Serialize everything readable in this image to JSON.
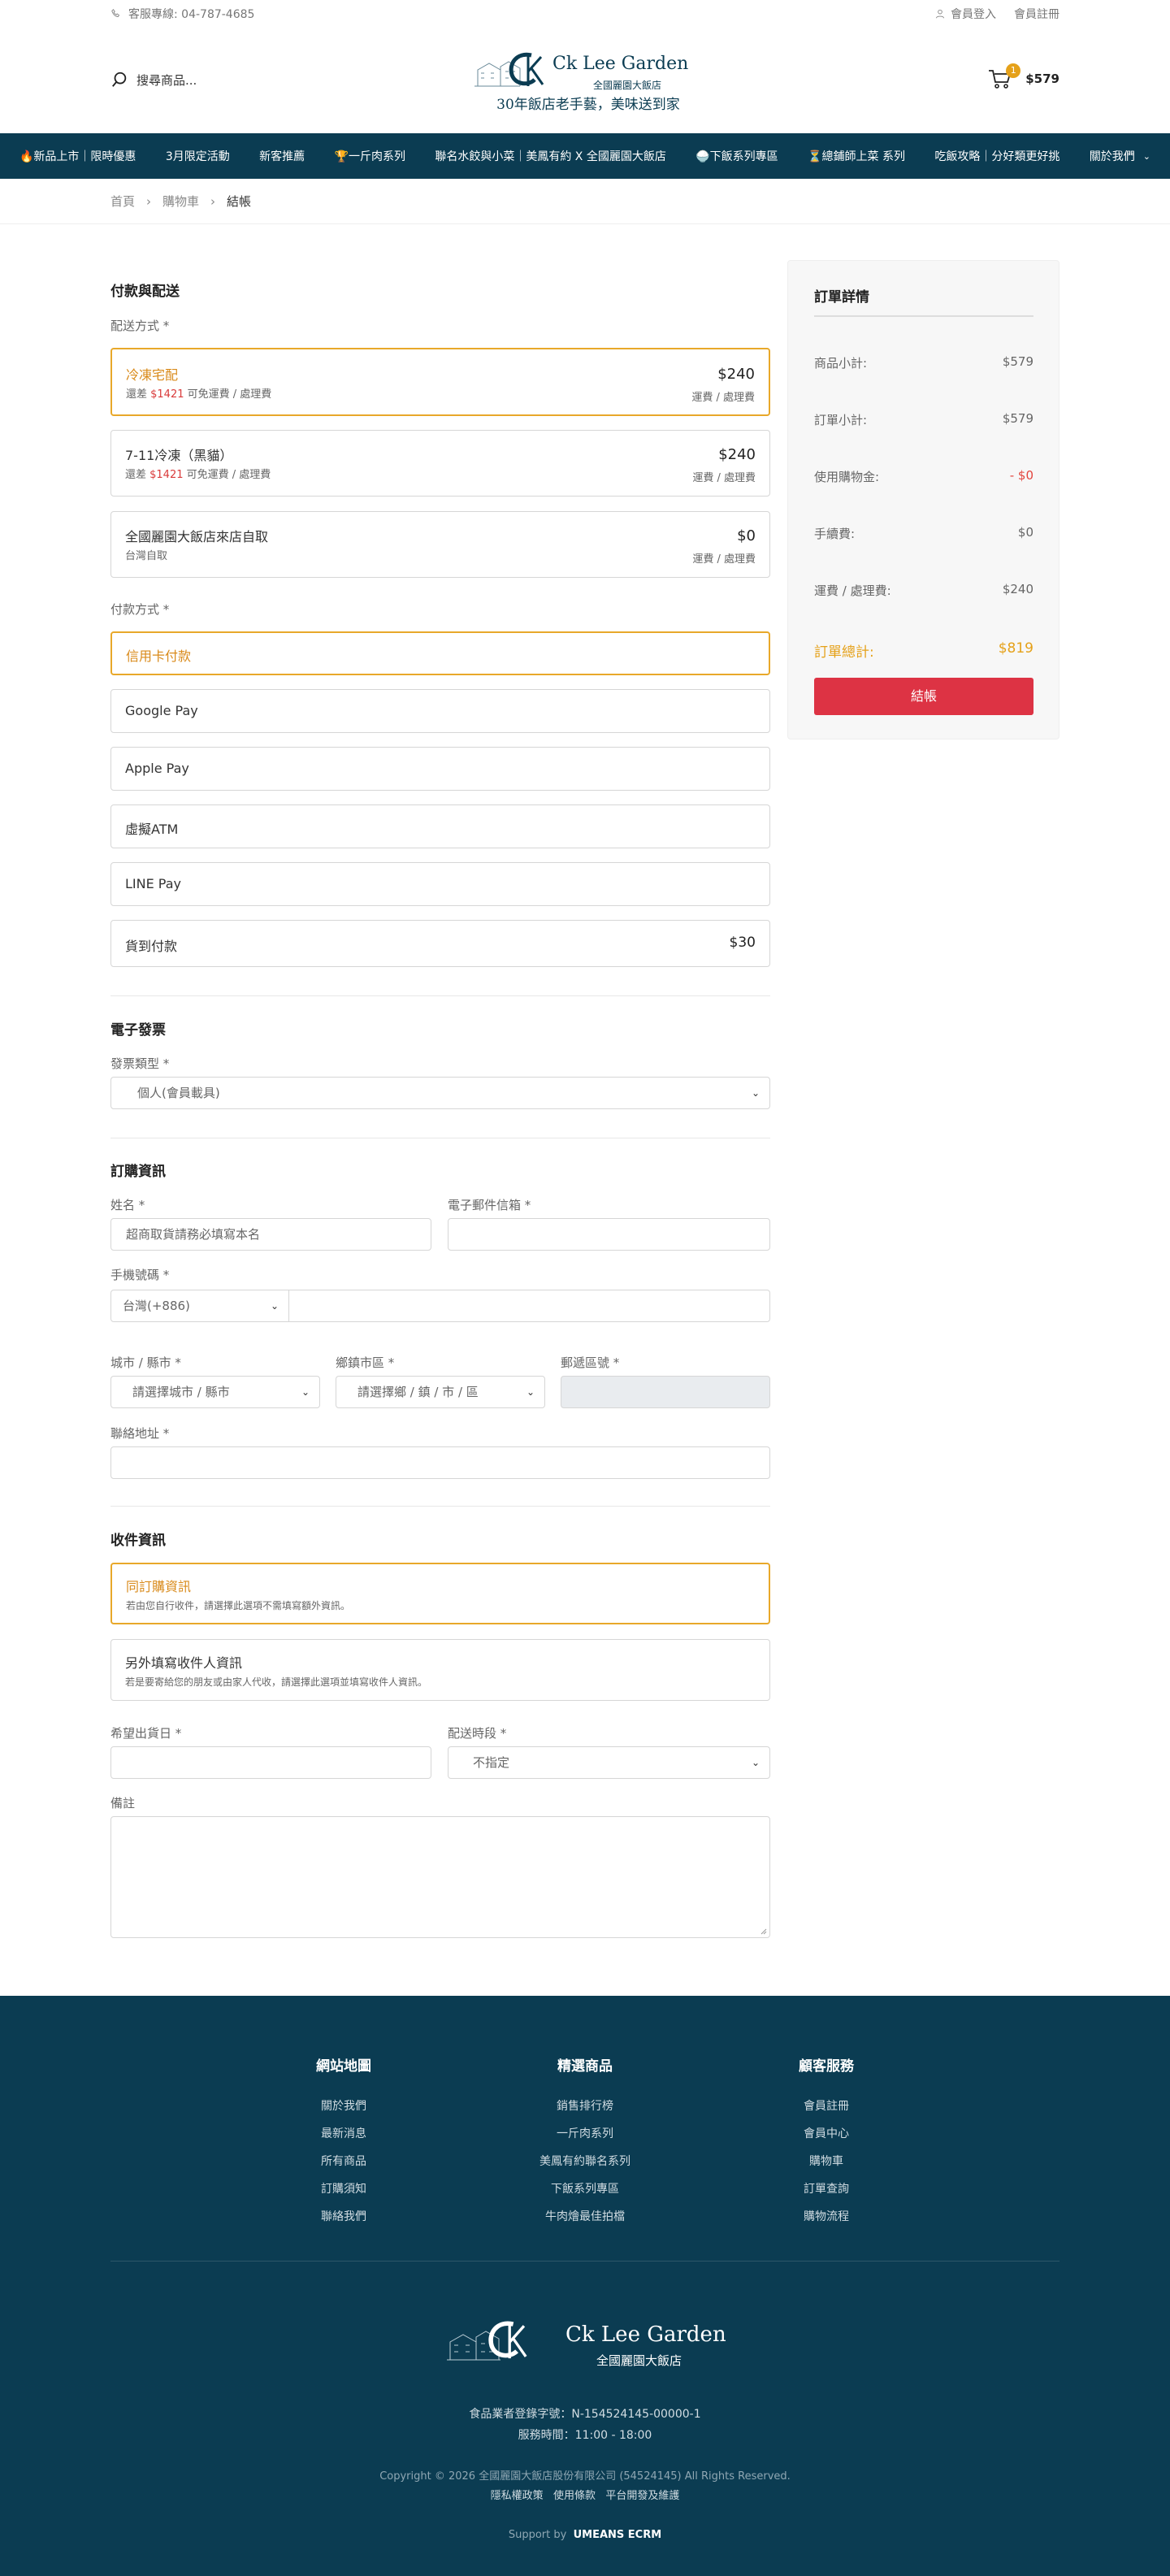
{
  "topbar": {
    "phone": "客服專線: 04-787-4685",
    "login": "會員登入",
    "register": "會員註冊"
  },
  "header": {
    "search_placeholder": "搜尋商品...",
    "logo_name": "Ck Lee Garden",
    "logo_sub": "全國麗園大飯店",
    "slogan": "30年飯店老手藝，美味送到家",
    "cart_count": "1",
    "cart_total": "$579"
  },
  "nav": [
    "🔥新品上市｜限時優惠",
    "3月限定活動",
    "新客推薦",
    "🏆一斤肉系列",
    "聯名水餃與小菜｜美鳳有約 X 全國麗園大飯店",
    "🍚下飯系列專區",
    "⏳總鋪師上菜 系列",
    "吃飯攻略｜分好類更好挑",
    "關於我們"
  ],
  "breadcrumb": {
    "home": "首頁",
    "cart": "購物車",
    "current": "結帳"
  },
  "payment_section": {
    "title": "付款與配送",
    "shipping_label": "配送方式 *",
    "shipping": [
      {
        "name": "冷凍宅配",
        "note_pre": "還差 ",
        "note_amt": "$1421",
        "note_post": " 可免運費 / 處理費",
        "price": "$240",
        "price_note": "運費 / 處理費"
      },
      {
        "name": "7-11冷凍（黑貓）",
        "note_pre": "還差 ",
        "note_amt": "$1421",
        "note_post": " 可免運費 / 處理費",
        "price": "$240",
        "price_note": "運費 / 處理費"
      },
      {
        "name": "全國麗園大飯店來店自取",
        "note_pre": "台灣自取",
        "note_amt": "",
        "note_post": "",
        "price": "$0",
        "price_note": "運費 / 處理費"
      }
    ],
    "payment_label": "付款方式 *",
    "payments": [
      {
        "name": "信用卡付款",
        "price": ""
      },
      {
        "name": "Google Pay",
        "price": ""
      },
      {
        "name": "Apple Pay",
        "price": ""
      },
      {
        "name": "虛擬ATM",
        "price": ""
      },
      {
        "name": "LINE Pay",
        "price": ""
      },
      {
        "name": "貨到付款",
        "price": "$30"
      }
    ]
  },
  "invoice": {
    "title": "電子發票",
    "type_label": "發票類型 *",
    "type_value": "個人(會員載具)"
  },
  "order_info": {
    "title": "訂購資訊",
    "name_label": "姓名 *",
    "name_placeholder": "超商取貨請務必填寫本名",
    "email_label": "電子郵件信箱 *",
    "phone_label": "手機號碼 *",
    "phone_code": "台灣(+886)",
    "city_label": "城市 / 縣市 *",
    "city_value": "請選擇城市 / 縣市",
    "district_label": "鄉鎮市區 *",
    "district_value": "請選擇鄉 / 鎮 / 市 / 區",
    "zip_label": "郵遞區號 *",
    "address_label": "聯絡地址 *"
  },
  "recipient": {
    "title": "收件資訊",
    "options": [
      {
        "name": "同訂購資訊",
        "note": "若由您自行收件，請選擇此選項不需填寫額外資訊。"
      },
      {
        "name": "另外填寫收件人資訊",
        "note": "若是要寄給您的朋友或由家人代收，請選擇此選項並填寫收件人資訊。"
      }
    ],
    "date_label": "希望出貨日 *",
    "slot_label": "配送時段 *",
    "slot_value": "不指定",
    "note_label": "備註"
  },
  "summary": {
    "title": "訂單詳情",
    "rows": [
      {
        "label": "商品小計:",
        "value": "$579"
      },
      {
        "label": "訂單小計:",
        "value": "$579"
      },
      {
        "label": "使用購物金:",
        "value": "- $0"
      },
      {
        "label": "手續費:",
        "value": "$0"
      },
      {
        "label": "運費 / 處理費:",
        "value": "$240"
      }
    ],
    "total_label": "訂單總計:",
    "total_value": "$819",
    "checkout_label": "結帳"
  },
  "footer": {
    "columns": [
      {
        "title": "網站地圖",
        "items": [
          "關於我們",
          "最新消息",
          "所有商品",
          "訂購須知",
          "聯絡我們"
        ]
      },
      {
        "title": "精選商品",
        "items": [
          "銷售排行榜",
          "一斤肉系列",
          "美鳳有約聯名系列",
          "下飯系列專區",
          "牛肉燴最佳拍檔"
        ]
      },
      {
        "title": "顧客服務",
        "items": [
          "會員註冊",
          "會員中心",
          "購物車",
          "訂單查詢",
          "購物流程"
        ]
      }
    ],
    "logo_name": "Ck Lee Garden",
    "logo_sub": "全國麗園大飯店",
    "license": "食品業者登錄字號：N-154524145-00000-1",
    "hours": "服務時間：11:00 - 18:00",
    "copyright": "Copyright © 2026 全國麗園大飯店股份有限公司 (54524145) All Rights Reserved.",
    "links": [
      "隱私權政策",
      "使用條款",
      "平台開發及維護"
    ],
    "support_pre": "Support by",
    "support_brand": "UMEANS ECRM"
  },
  "colors": {
    "brand": "#0b3c52",
    "accent": "#e8a82a",
    "checkout": "#dd3344"
  }
}
